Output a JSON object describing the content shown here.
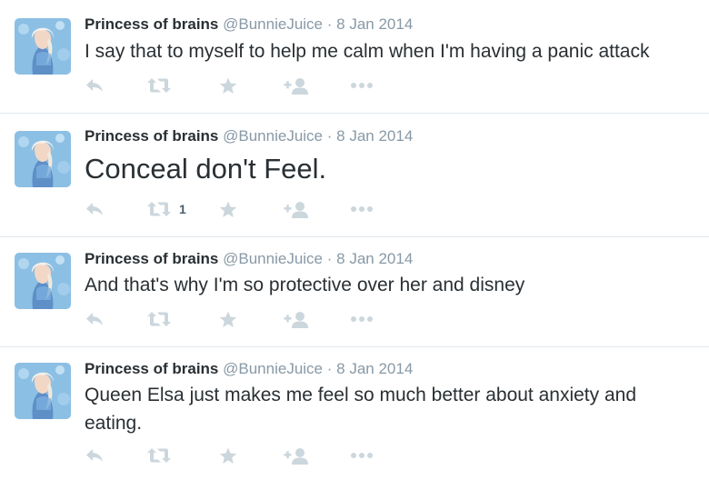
{
  "colors": {
    "text": "#292f33",
    "muted": "#8899a6",
    "icon": "#ccd6dd",
    "border": "#e1e8ed",
    "avatar_bg": "#7fb0d8"
  },
  "icons": {
    "reply": "reply-icon",
    "retweet": "retweet-icon",
    "favorite": "star-icon",
    "follow": "follow-icon",
    "more": "more-icon"
  },
  "tweets": [
    {
      "name": "Princess of brains",
      "handle": "@BunnieJuice",
      "separator": "·",
      "time": "8 Jan 2014",
      "text": "I say that to myself to help me calm when I'm having a panic attack",
      "retweet_count": ""
    },
    {
      "name": "Princess of brains",
      "handle": "@BunnieJuice",
      "separator": "·",
      "time": "8 Jan 2014",
      "text": "Conceal don't Feel.",
      "retweet_count": "1"
    },
    {
      "name": "Princess of brains",
      "handle": "@BunnieJuice",
      "separator": "·",
      "time": "8 Jan 2014",
      "text": "And that's why I'm so protective over her and disney",
      "retweet_count": ""
    },
    {
      "name": "Princess of brains",
      "handle": "@BunnieJuice",
      "separator": "·",
      "time": "8 Jan 2014",
      "text": "Queen Elsa just makes me feel so much better about anxiety and eating.",
      "retweet_count": ""
    }
  ]
}
